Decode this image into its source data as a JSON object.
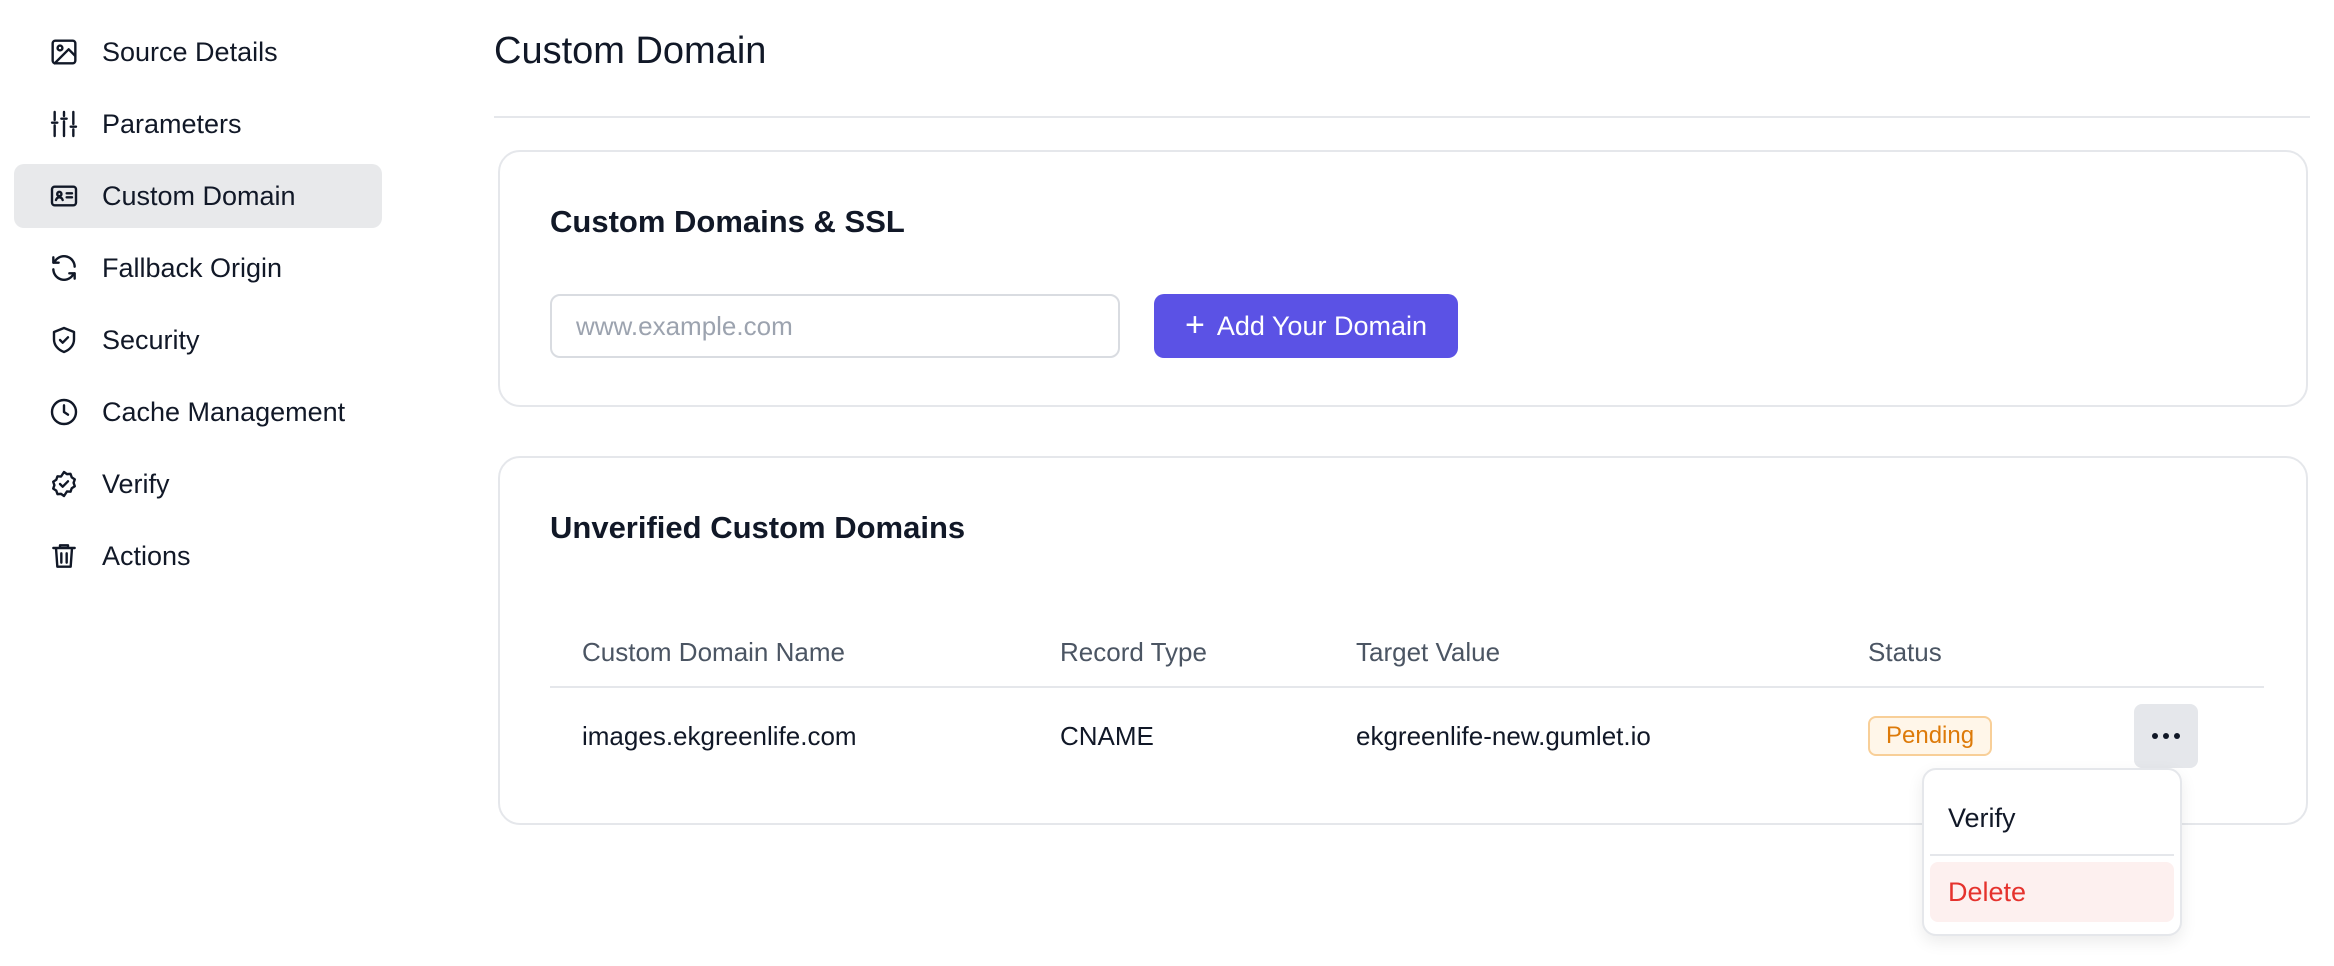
{
  "sidebar": {
    "items": [
      {
        "label": "Source Details",
        "icon": "image-icon",
        "active": false
      },
      {
        "label": "Parameters",
        "icon": "sliders-icon",
        "active": false
      },
      {
        "label": "Custom Domain",
        "icon": "id-card-icon",
        "active": true
      },
      {
        "label": "Fallback Origin",
        "icon": "refresh-icon",
        "active": false
      },
      {
        "label": "Security",
        "icon": "shield-check-icon",
        "active": false
      },
      {
        "label": "Cache Management",
        "icon": "clock-icon",
        "active": false
      },
      {
        "label": "Verify",
        "icon": "badge-check-icon",
        "active": false
      },
      {
        "label": "Actions",
        "icon": "trash-icon",
        "active": false
      }
    ]
  },
  "main": {
    "title": "Custom Domain",
    "ssl_card": {
      "title": "Custom Domains & SSL",
      "input_placeholder": "www.example.com",
      "input_value": "",
      "add_button_label": "Add Your Domain"
    },
    "unverified_card": {
      "title": "Unverified Custom Domains",
      "columns": [
        "Custom Domain Name",
        "Record Type",
        "Target Value",
        "Status"
      ],
      "rows": [
        {
          "domain": "images.ekgreenlife.com",
          "record_type": "CNAME",
          "target": "ekgreenlife-new.gumlet.io",
          "status": "Pending"
        }
      ]
    },
    "row_menu": {
      "verify_label": "Verify",
      "delete_label": "Delete"
    }
  },
  "colors": {
    "accent": "#5b52e5",
    "pending_text": "#dd7a09",
    "pending_border": "#f8cf98",
    "delete": "#e5322d",
    "active_nav_bg": "#e8e9eb"
  }
}
